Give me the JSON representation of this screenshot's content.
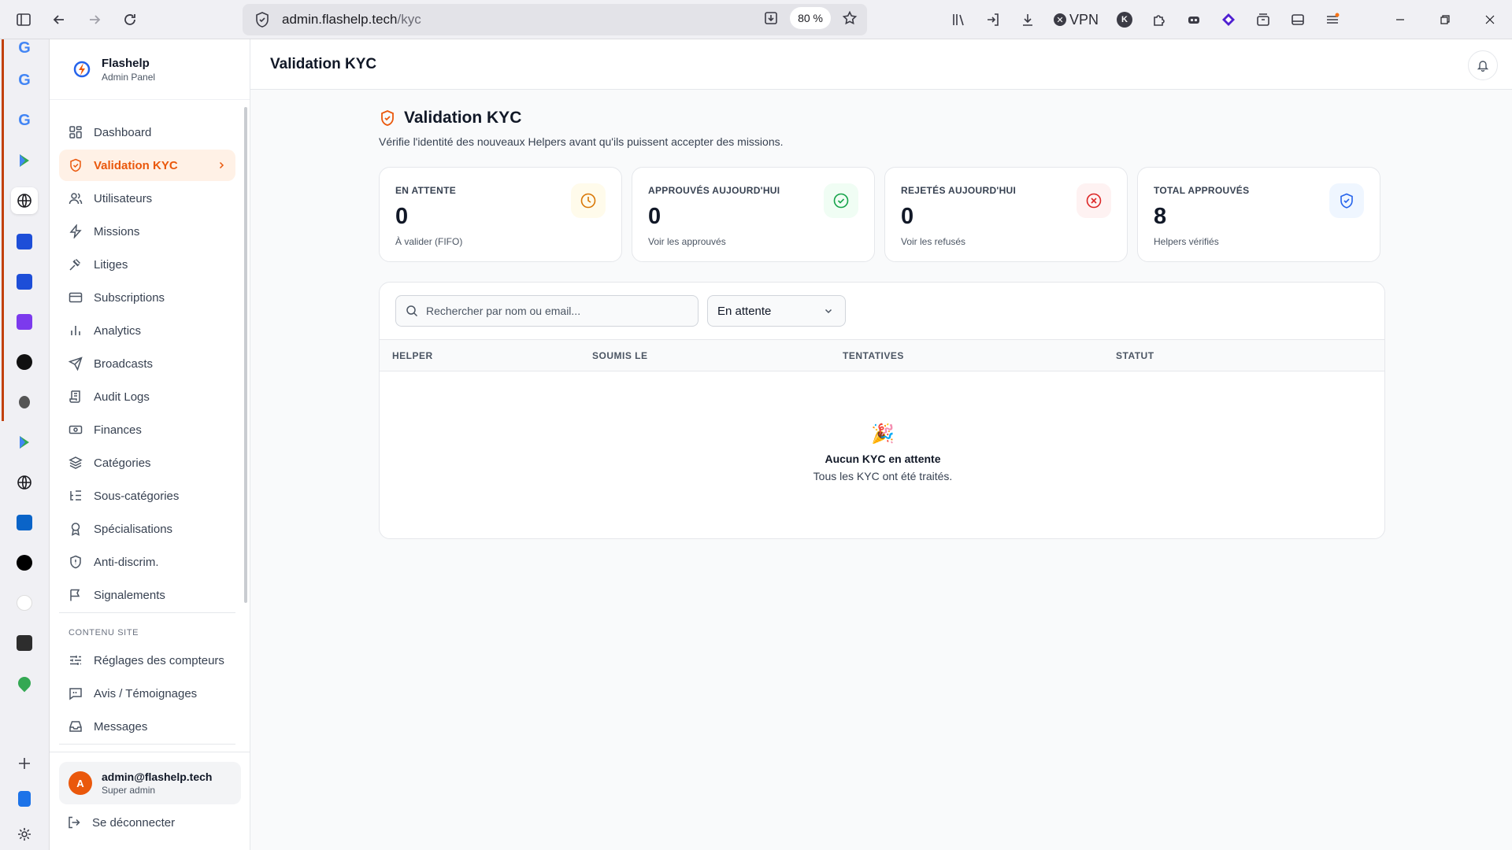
{
  "browser": {
    "url_domain": "admin.flashelp.tech",
    "url_path": "/kyc",
    "zoom": "80 %",
    "vpn_label": "VPN"
  },
  "app": {
    "brand_title": "Flashelp",
    "brand_subtitle": "Admin Panel",
    "header_title": "Validation KYC",
    "accent_color": "#ea580c"
  },
  "sidebar": {
    "items": [
      {
        "label": "Dashboard",
        "icon": "dashboard-icon"
      },
      {
        "label": "Validation KYC",
        "icon": "shield-check-icon",
        "active": true
      },
      {
        "label": "Utilisateurs",
        "icon": "users-icon"
      },
      {
        "label": "Missions",
        "icon": "lightning-icon"
      },
      {
        "label": "Litiges",
        "icon": "gavel-icon"
      },
      {
        "label": "Subscriptions",
        "icon": "credit-card-icon"
      },
      {
        "label": "Analytics",
        "icon": "bar-chart-icon"
      },
      {
        "label": "Broadcasts",
        "icon": "send-icon"
      },
      {
        "label": "Audit Logs",
        "icon": "scroll-icon"
      },
      {
        "label": "Finances",
        "icon": "banknote-icon"
      },
      {
        "label": "Catégories",
        "icon": "layers-icon"
      },
      {
        "label": "Sous-catégories",
        "icon": "list-tree-icon"
      },
      {
        "label": "Spécialisations",
        "icon": "award-icon"
      },
      {
        "label": "Anti-discrim.",
        "icon": "shield-icon"
      },
      {
        "label": "Signalements",
        "icon": "flag-icon"
      }
    ],
    "section_label": "CONTENU SITE",
    "section_items": [
      {
        "label": "Réglages des compteurs",
        "icon": "sliders-icon"
      },
      {
        "label": "Avis / Témoignages",
        "icon": "message-quote-icon"
      },
      {
        "label": "Messages",
        "icon": "inbox-icon"
      }
    ],
    "user": {
      "avatar_letter": "A",
      "email": "admin@flashelp.tech",
      "role": "Super admin"
    },
    "logout_label": "Se déconnecter"
  },
  "page": {
    "title": "Validation KYC",
    "description": "Vérifie l'identité des nouveaux Helpers avant qu'ils puissent accepter des missions."
  },
  "stats": [
    {
      "label": "EN ATTENTE",
      "value": "0",
      "sub": "À valider (FIFO)",
      "icon": "clock-icon",
      "color": "#d97706",
      "bg": "#fffbeb"
    },
    {
      "label": "APPROUVÉS AUJOURD'HUI",
      "value": "0",
      "sub": "Voir les approuvés",
      "icon": "check-circle-icon",
      "color": "#16a34a",
      "bg": "#f0fdf4"
    },
    {
      "label": "REJETÉS AUJOURD'HUI",
      "value": "0",
      "sub": "Voir les refusés",
      "icon": "x-circle-icon",
      "color": "#dc2626",
      "bg": "#fef2f2"
    },
    {
      "label": "TOTAL APPROUVÉS",
      "value": "8",
      "sub": "Helpers vérifiés",
      "icon": "shield-check-icon",
      "color": "#2563eb",
      "bg": "#eff6ff"
    }
  ],
  "filters": {
    "search_placeholder": "Rechercher par nom ou email...",
    "status_value": "En attente"
  },
  "table": {
    "columns": [
      "HELPER",
      "SOUMIS LE",
      "TENTATIVES",
      "STATUT"
    ],
    "empty_icon": "🎉",
    "empty_title": "Aucun KYC en attente",
    "empty_subtitle": "Tous les KYC ont été traités."
  }
}
